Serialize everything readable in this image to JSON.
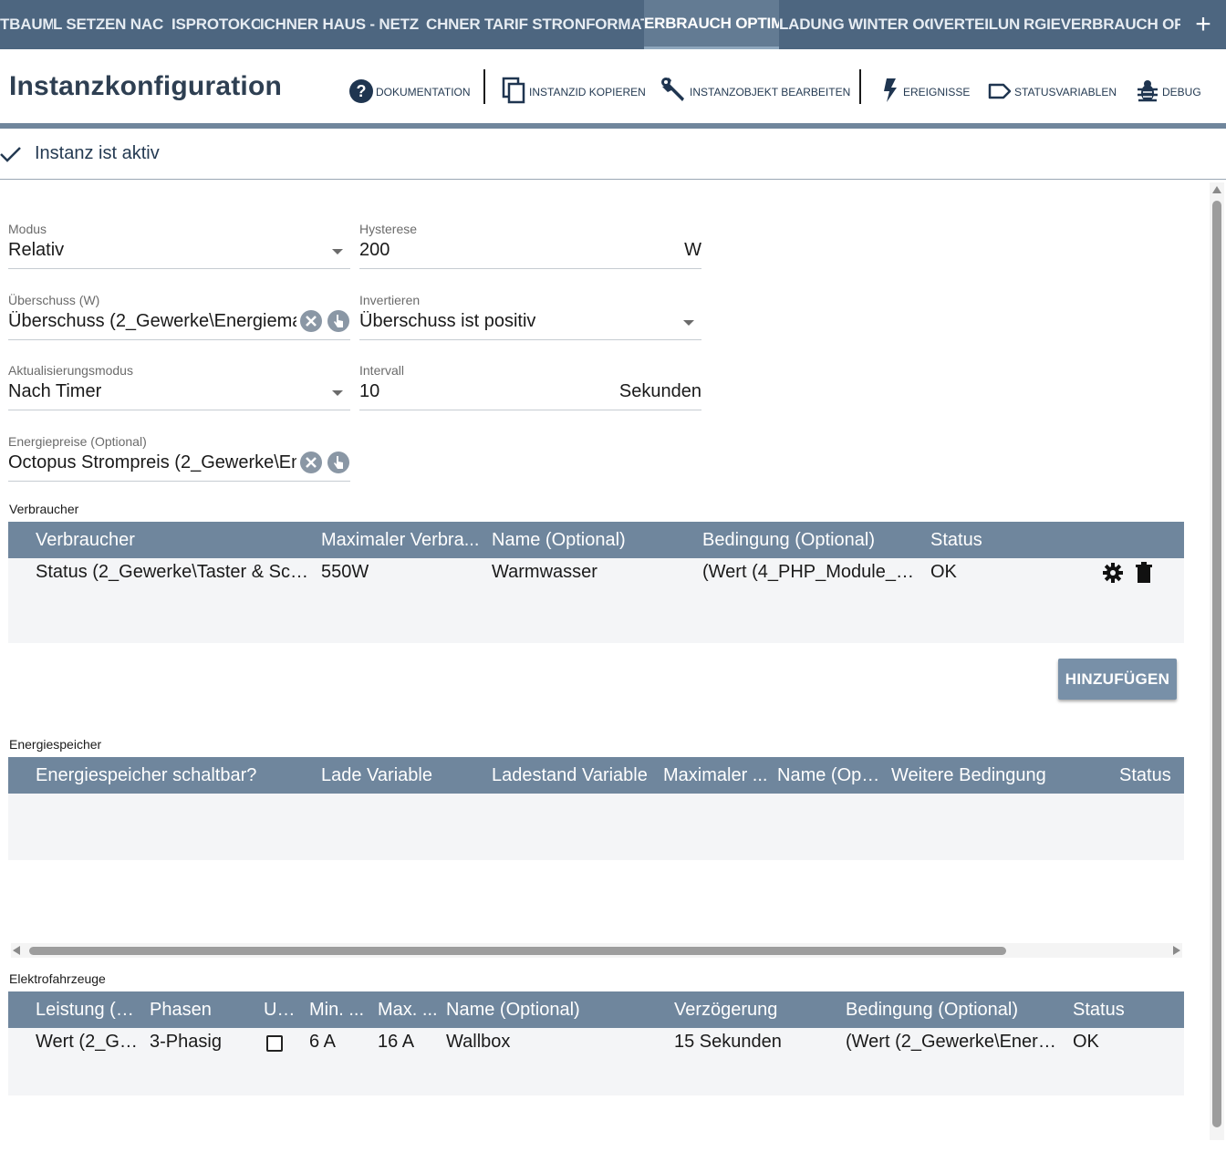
{
  "tabs": [
    {
      "label": "TBAUM"
    },
    {
      "label": "L SETZEN NAC"
    },
    {
      "label": "ISPROTOKO"
    },
    {
      "label": "ICHNER HAUS - NETZ"
    },
    {
      "label": "CHNER TARIF STROM"
    },
    {
      "label": "NFORMATIO"
    },
    {
      "label": "ERBRAUCH OPTIM"
    },
    {
      "label": "LADUNG WINTER OC"
    },
    {
      "label": "IVERTEILUN"
    },
    {
      "label": "RGIEVERBRAUCH OPTI"
    }
  ],
  "tab_add_label": "+",
  "header": {
    "title": "Instanzkonfiguration",
    "buttons": {
      "documentation": "Dokumentation",
      "copy_id": "InstanzID kopieren",
      "edit_object": "Instanzobjekt bearbeiten",
      "events": "Ereignisse",
      "status_variables": "Statusvariablen",
      "debug": "Debug"
    }
  },
  "instance_active": "Instanz ist aktiv",
  "form": {
    "modus": {
      "label": "Modus",
      "value": "Relativ"
    },
    "hysterese": {
      "label": "Hysterese",
      "value": "200",
      "unit": "W"
    },
    "ueberschuss": {
      "label": "Überschuss (W)",
      "value": "Überschuss (2_Gewerke\\Energiema"
    },
    "invertieren": {
      "label": "Invertieren",
      "value": "Überschuss ist positiv"
    },
    "aktualisierungsmodus": {
      "label": "Aktualisierungsmodus",
      "value": "Nach Timer"
    },
    "intervall": {
      "label": "Intervall",
      "value": "10",
      "unit": "Sekunden"
    },
    "energiepreise": {
      "label": "Energiepreise (Optional)",
      "value": "Octopus Strompreis (2_Gewerke\\En"
    }
  },
  "verbraucher": {
    "section_label": "Verbraucher",
    "columns": [
      "Verbraucher",
      "Maximaler Verbra...",
      "Name (Optional)",
      "Bedingung (Optional)",
      "Status"
    ],
    "rows": [
      {
        "verbraucher": "Status (2_Gewerke\\Taster & Sch...",
        "max": "550W",
        "name": "Warmwasser",
        "bedingung": "(Wert (4_PHP_Module_ä...",
        "status": "OK"
      }
    ],
    "add_button": "HINZUFÜGEN"
  },
  "energiespeicher": {
    "section_label": "Energiespeicher",
    "columns": [
      "Energiespeicher schaltbar?",
      "Lade Variable",
      "Ladestand Variable",
      "Maximaler ...",
      "Name (Opti...",
      "Weitere Bedingung",
      "Status"
    ]
  },
  "elektrofahrzeuge": {
    "section_label": "Elektrofahrzeuge",
    "columns": [
      "Leistung (S...",
      "Phasen",
      "Un...",
      "Min. ...",
      "Max. ...",
      "Name (Optional)",
      "Verzögerung",
      "Bedingung (Optional)",
      "Status"
    ],
    "rows": [
      {
        "leistung": "Wert (2_Ge...",
        "phasen": "3-Phasig",
        "min": "6 A",
        "max": "16 A",
        "name": "Wallbox",
        "verzoegerung": "15 Sekunden",
        "bedingung": "(Wert (2_Gewerke\\Energi...",
        "status": "OK"
      }
    ]
  }
}
